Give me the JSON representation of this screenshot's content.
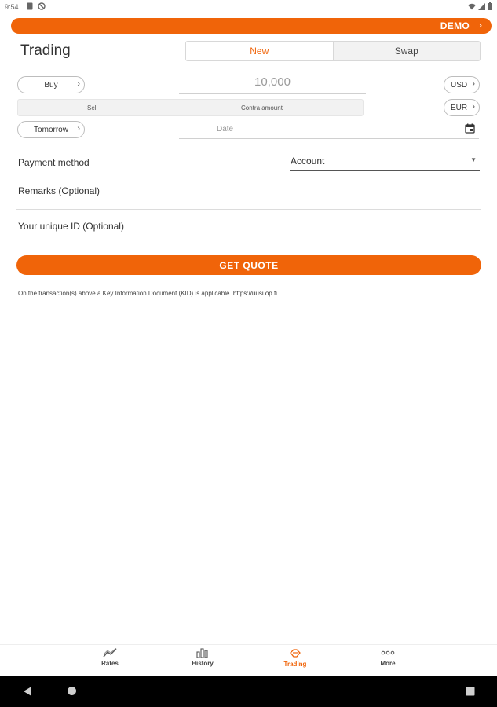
{
  "status_bar": {
    "time": "9:54"
  },
  "demo_bar": {
    "label": "DEMO"
  },
  "header": {
    "title": "Trading"
  },
  "tabs": [
    {
      "label": "New",
      "active": true
    },
    {
      "label": "Swap",
      "active": false
    }
  ],
  "trade": {
    "direction": "Buy",
    "amount": "10,000",
    "buy_currency": "USD",
    "sell_label": "Sell",
    "contra_label": "Contra amount",
    "sell_currency": "EUR",
    "value_date": "Tomorrow",
    "date_placeholder": "Date"
  },
  "form": {
    "payment_method_label": "Payment method",
    "payment_method_value": "Account",
    "remarks_label": "Remarks (Optional)",
    "unique_id_label": "Your unique ID (Optional)"
  },
  "actions": {
    "get_quote": "GET QUOTE"
  },
  "footer_note": {
    "text": "On the transaction(s) above a Key Information Document (KID) is applicable.",
    "link": "https://uusi.op.fi"
  },
  "bottom_nav": [
    {
      "label": "Rates",
      "icon": "rates-icon",
      "active": false
    },
    {
      "label": "History",
      "icon": "history-icon",
      "active": false
    },
    {
      "label": "Trading",
      "icon": "trading-icon",
      "active": true
    },
    {
      "label": "More",
      "icon": "more-icon",
      "active": false
    }
  ],
  "colors": {
    "accent": "#f06409",
    "text": "#333333",
    "divider": "#dcdcdc"
  }
}
